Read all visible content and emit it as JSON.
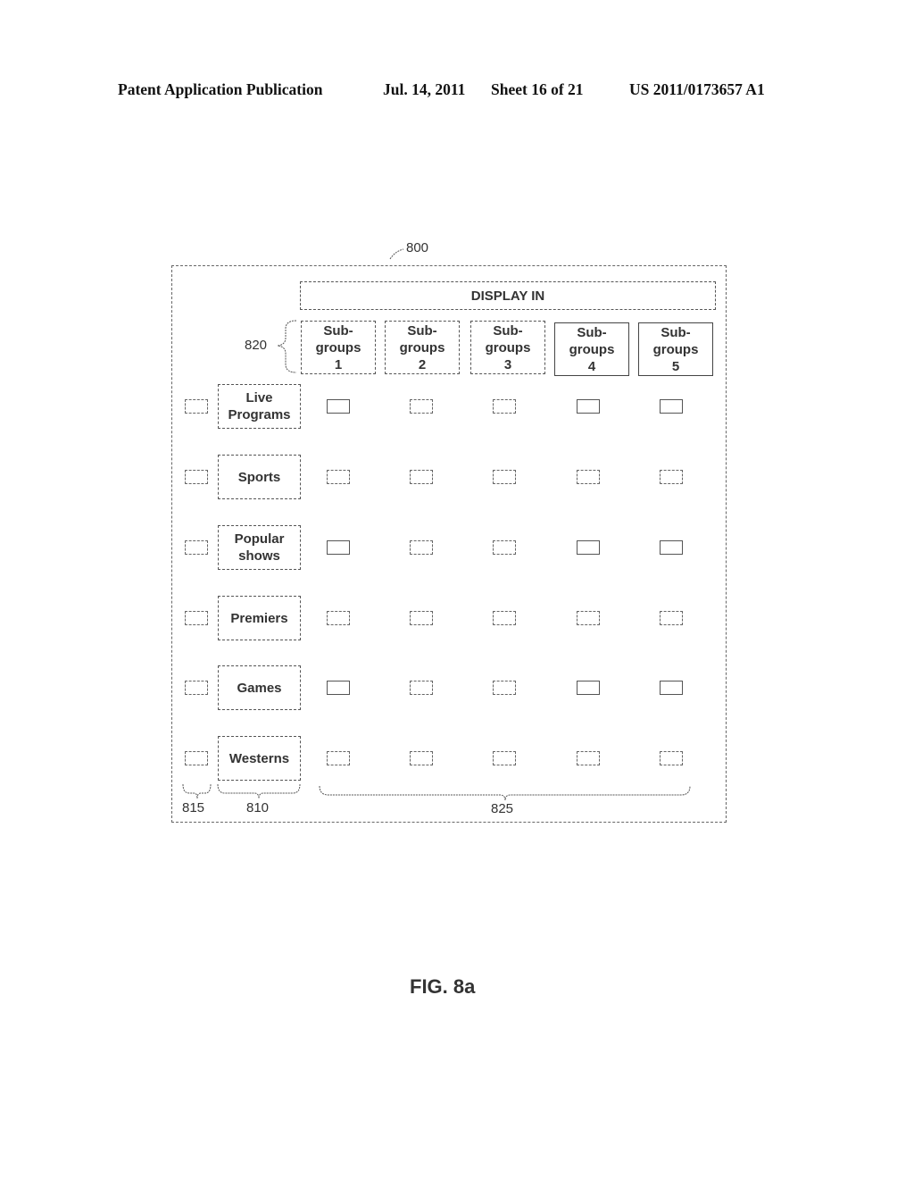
{
  "header": {
    "publication": "Patent Application Publication",
    "date": "Jul. 14, 2011",
    "sheet": "Sheet 16 of 21",
    "number": "US 2011/0173657 A1"
  },
  "figure": {
    "ref_main": "800",
    "ref_subgroups": "820",
    "ref_row_checkboxes": "815",
    "ref_categories": "810",
    "ref_grid_checkboxes": "825",
    "caption": "FIG. 8a"
  },
  "display_in": {
    "label": "DISPLAY IN"
  },
  "subgroups": [
    {
      "line1": "Sub-",
      "line2": "groups",
      "line3": "1"
    },
    {
      "line1": "Sub-",
      "line2": "groups",
      "line3": "2"
    },
    {
      "line1": "Sub-",
      "line2": "groups",
      "line3": "3"
    },
    {
      "line1": "Sub-",
      "line2": "groups",
      "line3": "4"
    },
    {
      "line1": "Sub-",
      "line2": "groups",
      "line3": "5"
    }
  ],
  "categories": [
    {
      "line1": "Live",
      "line2": "Programs"
    },
    {
      "line1": "Sports",
      "line2": ""
    },
    {
      "line1": "Popular",
      "line2": "shows"
    },
    {
      "line1": "Premiers",
      "line2": ""
    },
    {
      "line1": "Games",
      "line2": ""
    },
    {
      "line1": "Westerns",
      "line2": ""
    }
  ],
  "checkbox_state": {
    "row_checkboxes_checked": [
      false,
      false,
      false,
      false,
      false,
      false
    ],
    "grid_checked": [
      [
        false,
        false,
        false,
        false,
        false
      ],
      [
        false,
        false,
        false,
        false,
        false
      ],
      [
        false,
        false,
        false,
        false,
        false
      ],
      [
        false,
        false,
        false,
        false,
        false
      ],
      [
        false,
        false,
        false,
        false,
        false
      ],
      [
        false,
        false,
        false,
        false,
        false
      ]
    ]
  }
}
